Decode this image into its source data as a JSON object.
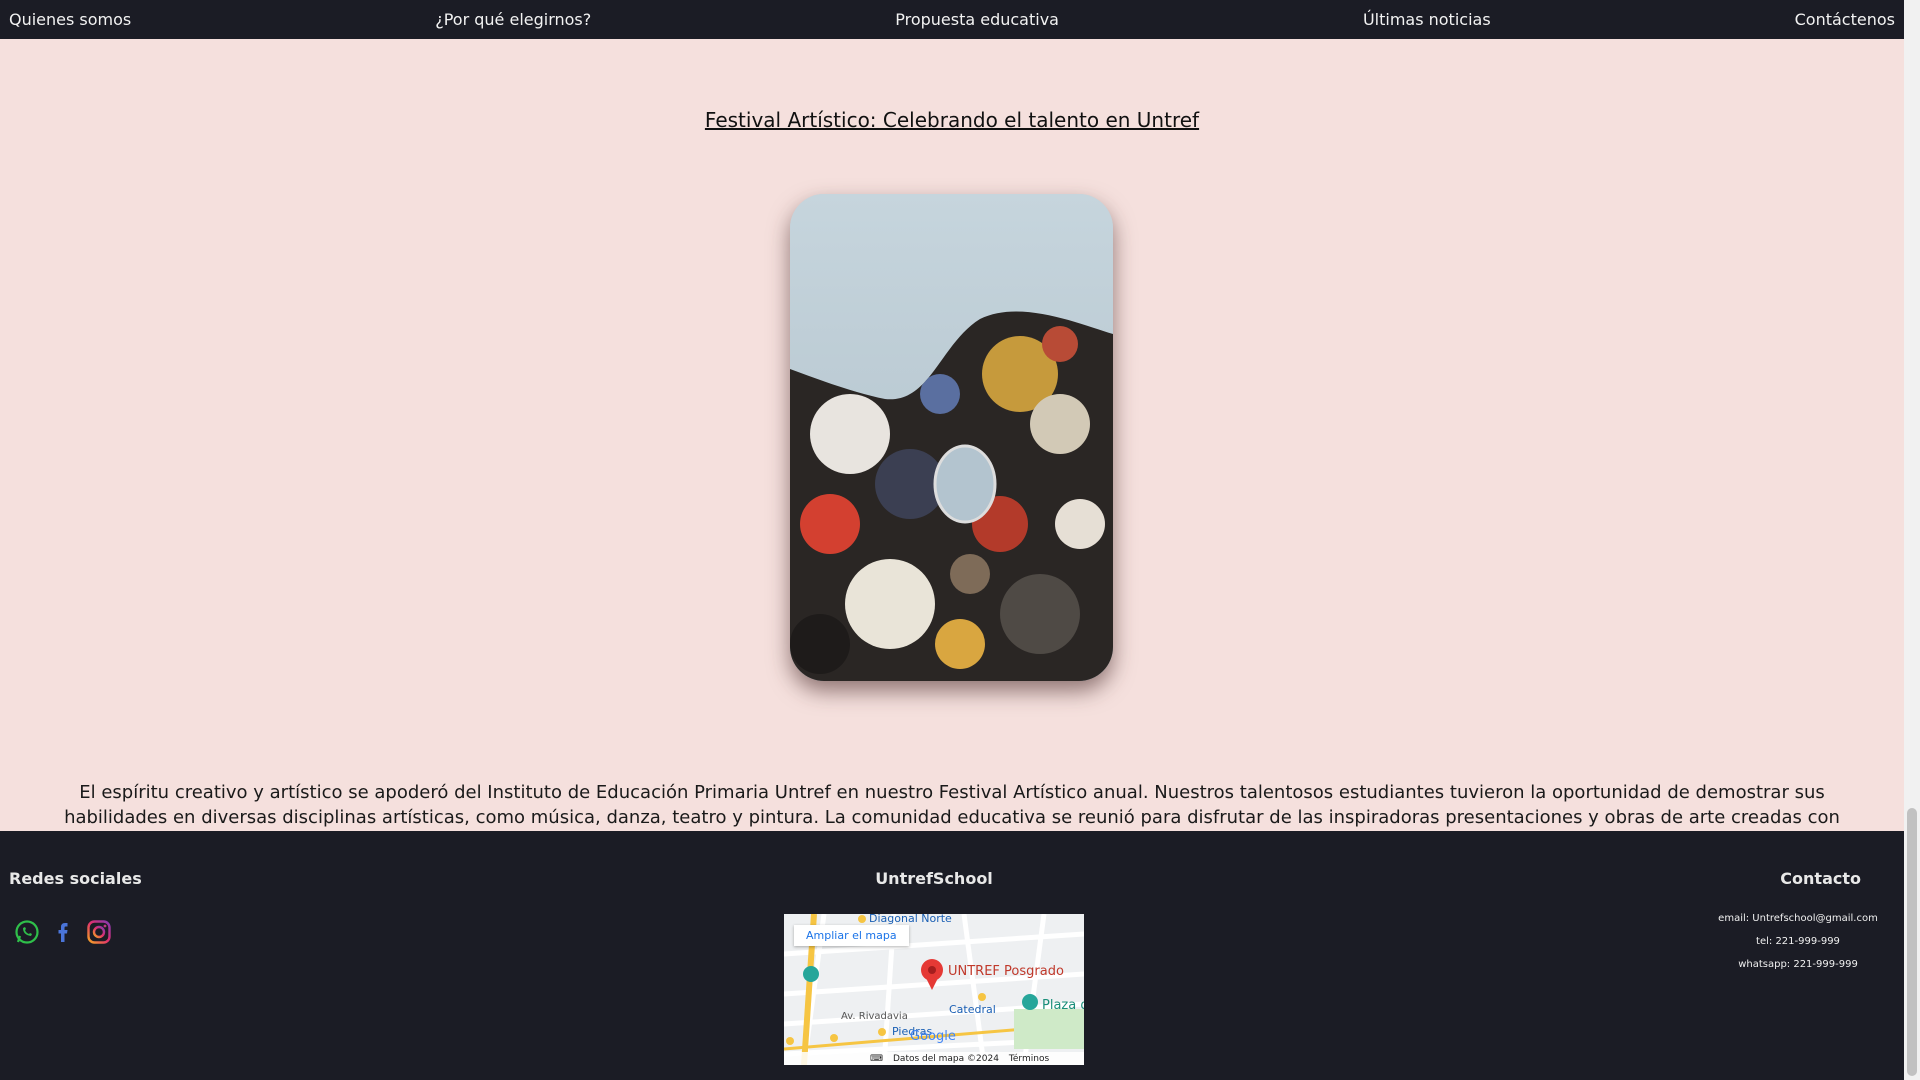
{
  "nav": {
    "items": [
      "Quienes somos",
      "¿Por qué elegirnos?",
      "Propuesta educativa",
      "Últimas noticias",
      "Contáctenos"
    ]
  },
  "article": {
    "title": "Festival Artístico: Celebrando el talento en Untref",
    "body": "El espíritu creativo y artístico se apoderó del Instituto de Educación Primaria Untref en nuestro Festival Artístico anual. Nuestros talentosos estudiantes tuvieron la oportunidad de demostrar sus habilidades en diversas disciplinas artísticas, como música, danza, teatro y pintura. La comunidad educativa se reunió para disfrutar de las inspiradoras presentaciones y obras de arte creadas con pasión y dedicación por los niños."
  },
  "footer": {
    "social_title": "Redes sociales",
    "social_icons": [
      "whatsapp-icon",
      "facebook-icon",
      "instagram-icon"
    ],
    "school_title": "UntrefSchool",
    "contact_title": "Contacto",
    "contact_lines": [
      "email: Untrefschool@gmail.com",
      "tel: 221-999-999",
      "whatsapp: 221-999-999"
    ],
    "map": {
      "button": "Ampliar el mapa",
      "labels": [
        "Diagonal Norte",
        "UNTREF Posgrado",
        "Catedral",
        "Plaza d",
        "Av. Rivadavia",
        "Piedras",
        "Google"
      ],
      "footer": [
        "Datos del mapa ©2024",
        "Términos"
      ]
    }
  },
  "colors": {
    "page_bg": "#f5e0dd",
    "nav_bg": "#1b1c25",
    "footer_bg": "#1b1c25"
  }
}
